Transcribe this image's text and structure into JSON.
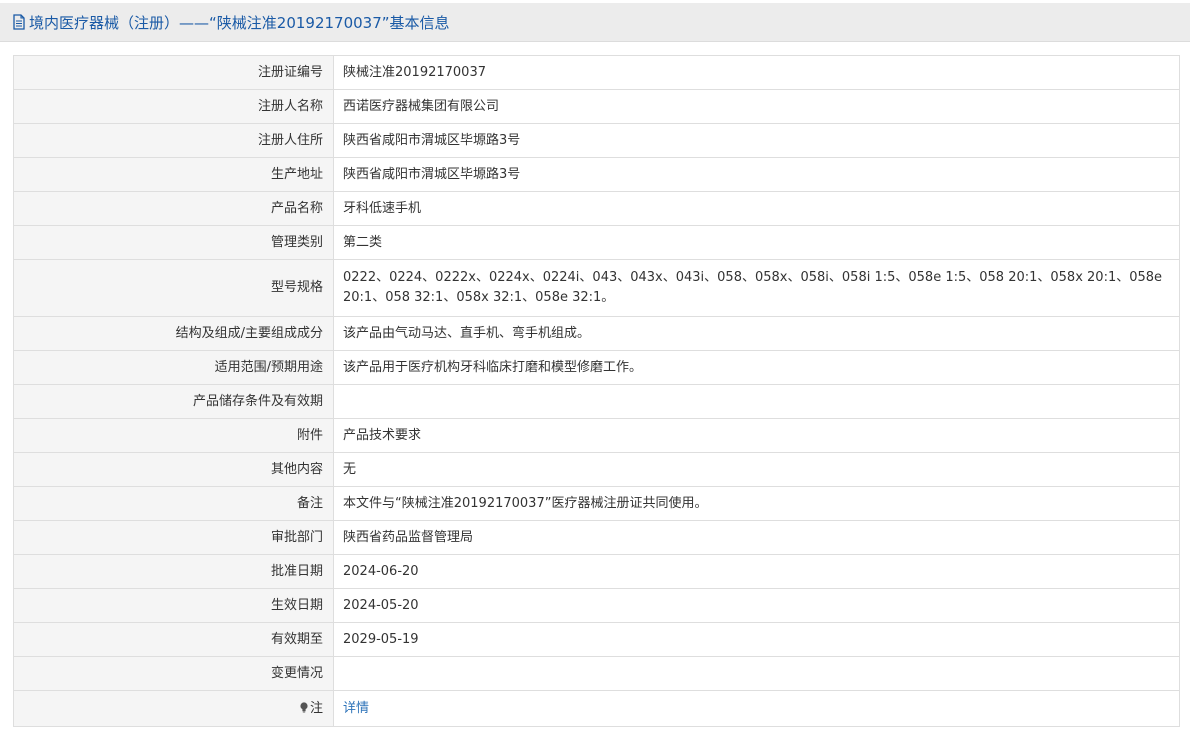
{
  "header": {
    "title": "境内医疗器械（注册）——“陕械注准20192170037”基本信息"
  },
  "rows": [
    {
      "key": "注册证编号",
      "value": "陕械注准20192170037"
    },
    {
      "key": "注册人名称",
      "value": "西诺医疗器械集团有限公司"
    },
    {
      "key": "注册人住所",
      "value": "陕西省咸阳市渭城区毕塬路3号"
    },
    {
      "key": "生产地址",
      "value": "陕西省咸阳市渭城区毕塬路3号"
    },
    {
      "key": "产品名称",
      "value": "牙科低速手机"
    },
    {
      "key": "管理类别",
      "value": "第二类"
    },
    {
      "key": "型号规格",
      "value": "0222、0224、0222x、0224x、0224i、043、043x、043i、058、058x、058i、058i 1:5、058e 1:5、058 20:1、058x 20:1、058e 20:1、058 32:1、058x 32:1、058e 32:1。"
    },
    {
      "key": "结构及组成/主要组成成分",
      "value": "该产品由气动马达、直手机、弯手机组成。"
    },
    {
      "key": "适用范围/预期用途",
      "value": "该产品用于医疗机构牙科临床打磨和模型修磨工作。"
    },
    {
      "key": "产品储存条件及有效期",
      "value": ""
    },
    {
      "key": "附件",
      "value": "产品技术要求"
    },
    {
      "key": "其他内容",
      "value": "无"
    },
    {
      "key": "备注",
      "value": "本文件与“陕械注准20192170037”医疗器械注册证共同使用。"
    },
    {
      "key": "审批部门",
      "value": "陕西省药品监督管理局"
    },
    {
      "key": "批准日期",
      "value": "2024-06-20"
    },
    {
      "key": "生效日期",
      "value": "2024-05-20"
    },
    {
      "key": "有效期至",
      "value": "2029-05-19"
    },
    {
      "key": "变更情况",
      "value": ""
    }
  ],
  "note_row": {
    "key": "注",
    "link_label": "详情",
    "icon": "lightbulb-icon"
  },
  "colors": {
    "title": "#1a5aa6",
    "link": "#2d73b9",
    "key_bg": "#f5f5f5",
    "border": "#dedede"
  }
}
